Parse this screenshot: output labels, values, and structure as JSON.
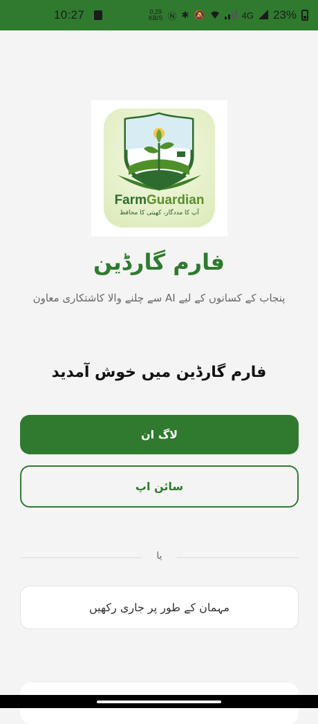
{
  "status_bar": {
    "time": "10:27",
    "speed_value": "0.29",
    "speed_unit": "KB/S",
    "network": "4G",
    "battery": "23%"
  },
  "logo": {
    "title_farm": "Farm",
    "title_guardian": "Guardian",
    "tagline": "آپ کا مددگار، کھیتی کا محافظ"
  },
  "app": {
    "title": "فارم گارڈین",
    "subtitle": "پنجاب کے کسانوں کے لیے AI سے چلنے والا کاشتکاری معاون"
  },
  "welcome": "فارم گارڈین میں خوش آمدید",
  "buttons": {
    "login": "لاگ ان",
    "signup": "سائن اپ",
    "guest": "مہمان کے طور پر جاری رکھیں"
  },
  "divider_text": "یا",
  "colors": {
    "primary": "#2f7a2f",
    "background": "#f4f4f4"
  }
}
